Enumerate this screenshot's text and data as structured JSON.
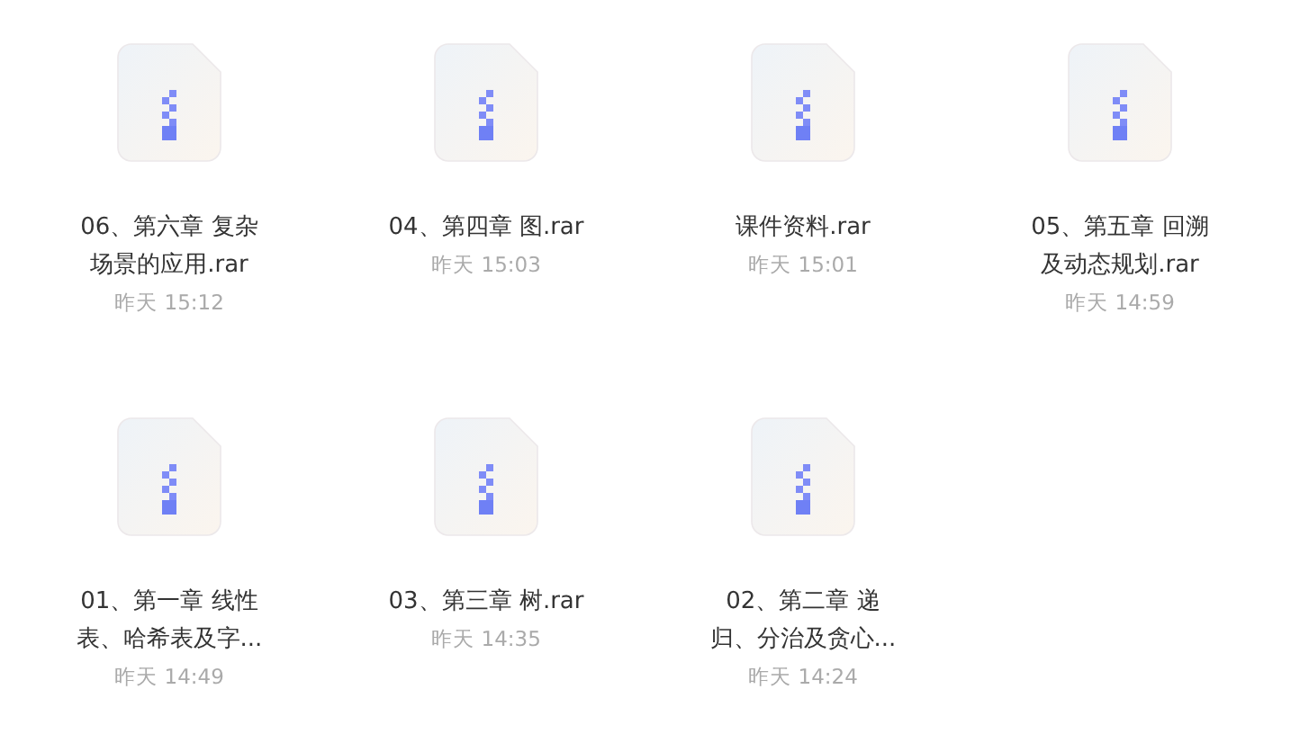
{
  "files": [
    {
      "name": "06、第六章 复杂场景的应用.rar",
      "time": "昨天 15:12"
    },
    {
      "name": "04、第四章 图.rar",
      "time": "昨天 15:03"
    },
    {
      "name": "课件资料.rar",
      "time": "昨天 15:01"
    },
    {
      "name": "05、第五章 回溯及动态规划.rar",
      "time": "昨天 14:59"
    },
    {
      "name": "01、第一章 线性表、哈希表及字...",
      "time": "昨天 14:49"
    },
    {
      "name": "03、第三章 树.rar",
      "time": "昨天 14:35"
    },
    {
      "name": "02、第二章 递归、分治及贪心...",
      "time": "昨天 14:24"
    }
  ]
}
